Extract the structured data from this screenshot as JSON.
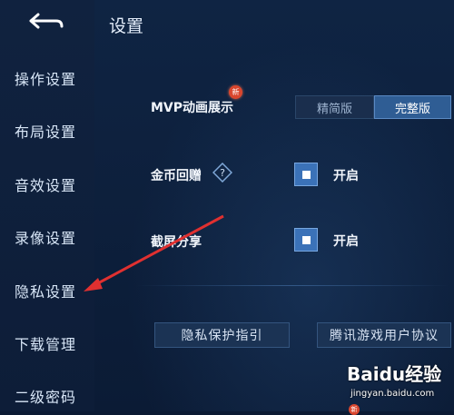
{
  "header": {
    "title": "设置"
  },
  "sidebar": {
    "items": [
      {
        "label": "操作设置"
      },
      {
        "label": "布局设置"
      },
      {
        "label": "音效设置"
      },
      {
        "label": "录像设置"
      },
      {
        "label": "隐私设置"
      },
      {
        "label": "下载管理"
      },
      {
        "label": "二级密码"
      }
    ]
  },
  "settings": {
    "mvp": {
      "label": "MVP动画展示",
      "badge": "新",
      "options": [
        "精简版",
        "完整版"
      ],
      "selected": "完整版"
    },
    "coin_gift": {
      "label": "金币回赠",
      "checkbox_label": "开启",
      "checked": true
    },
    "screenshot_share": {
      "label": "截屏分享",
      "checkbox_label": "开启",
      "checked": true
    }
  },
  "buttons": {
    "privacy_guide": "隐私保护指引",
    "user_agreement": "腾讯游戏用户协议"
  },
  "watermark": {
    "brand": "Baidu经验",
    "url": "jingyan.baidu.com"
  },
  "colors": {
    "accent": "#2f5d94",
    "annotation_arrow": "#e03030",
    "badge": "#d9462e"
  }
}
